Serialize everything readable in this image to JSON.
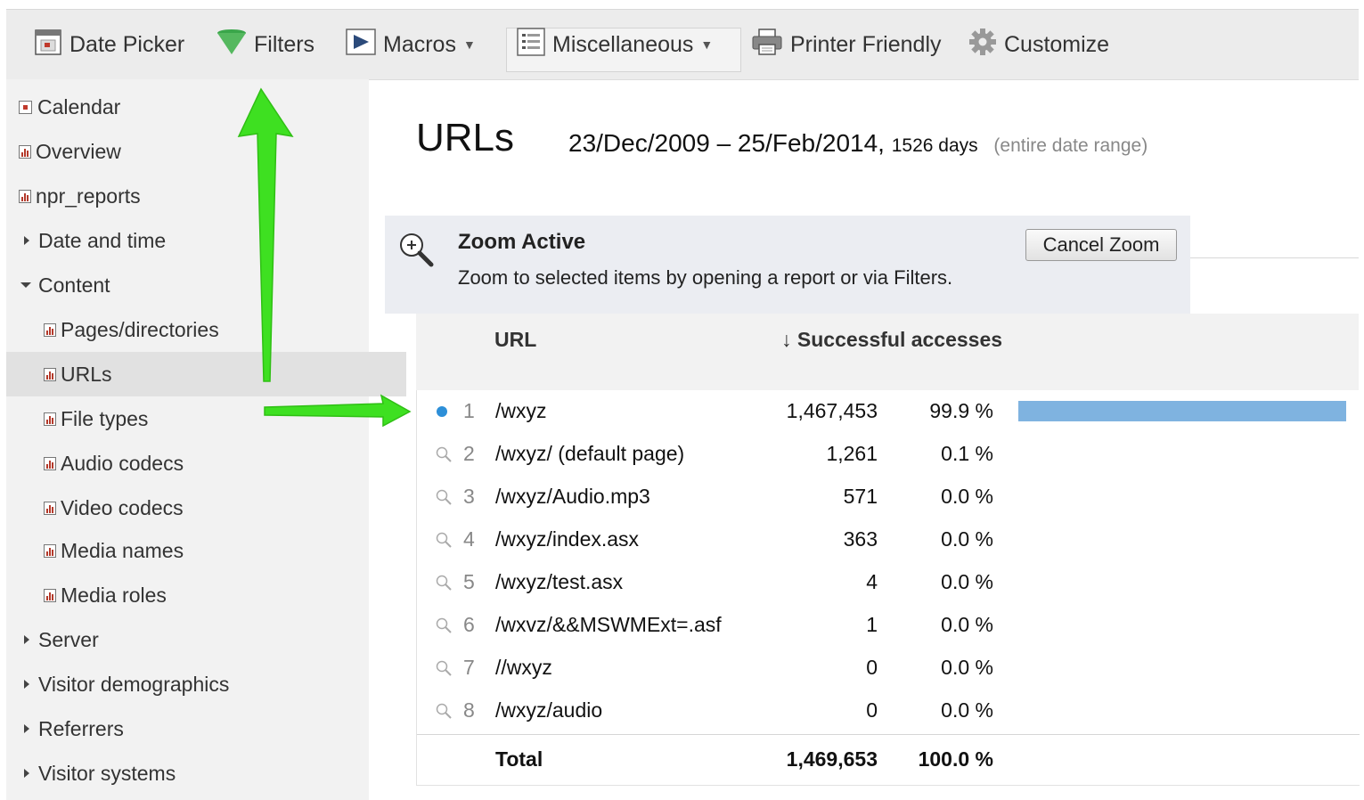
{
  "toolbar": {
    "date_picker": "Date Picker",
    "filters": "Filters",
    "macros": "Macros",
    "miscellaneous": "Miscellaneous",
    "printer_friendly": "Printer Friendly",
    "customize": "Customize"
  },
  "sidebar": {
    "items": [
      {
        "label": "Calendar",
        "icon": "calendar-icon"
      },
      {
        "label": "Overview",
        "icon": "report-icon"
      },
      {
        "label": "npr_reports",
        "icon": "report-icon"
      },
      {
        "label": "Date and time",
        "icon": "expand-arrow-icon"
      },
      {
        "label": "Content",
        "icon": "collapse-arrow-icon"
      },
      {
        "label": "Pages/directories",
        "icon": "report-icon"
      },
      {
        "label": "URLs",
        "icon": "report-icon",
        "selected": true
      },
      {
        "label": "File types",
        "icon": "report-icon"
      },
      {
        "label": "Audio codecs",
        "icon": "report-icon"
      },
      {
        "label": "Video codecs",
        "icon": "report-icon"
      },
      {
        "label": "Media names",
        "icon": "report-icon"
      },
      {
        "label": "Media roles",
        "icon": "report-icon"
      },
      {
        "label": "Server",
        "icon": "expand-arrow-icon"
      },
      {
        "label": "Visitor demographics",
        "icon": "expand-arrow-icon"
      },
      {
        "label": "Referrers",
        "icon": "expand-arrow-icon"
      },
      {
        "label": "Visitor systems",
        "icon": "expand-arrow-icon"
      }
    ]
  },
  "header": {
    "title": "URLs",
    "date_range": "23/Dec/2009 – 25/Feb/2014,",
    "days": "1526 days",
    "range_note": "(entire date range)"
  },
  "zoom": {
    "title": "Zoom Active",
    "description": "Zoom to selected items by opening a report or via Filters.",
    "cancel_label": "Cancel Zoom"
  },
  "table": {
    "col_url": "URL",
    "col_sort_arrow": "↓",
    "col_accesses": "Successful accesses",
    "rows": [
      {
        "rank": "1",
        "url": "/wxyz",
        "accesses": "1,467,453",
        "percent": "99.9 %",
        "fraction": 0.999
      },
      {
        "rank": "2",
        "url": "/wxyz/ (default page)",
        "accesses": "1,261",
        "percent": "0.1 %",
        "fraction": 0.001
      },
      {
        "rank": "3",
        "url": "/wxyz/Audio.mp3",
        "accesses": "571",
        "percent": "0.0 %",
        "fraction": 0.0
      },
      {
        "rank": "4",
        "url": "/wxyz/index.asx",
        "accesses": "363",
        "percent": "0.0 %",
        "fraction": 0.0
      },
      {
        "rank": "5",
        "url": "/wxyz/test.asx",
        "accesses": "4",
        "percent": "0.0 %",
        "fraction": 0.0
      },
      {
        "rank": "6",
        "url": "/wxvz/&&MSWMExt=.asf",
        "accesses": "1",
        "percent": "0.0 %",
        "fraction": 0.0
      },
      {
        "rank": "7",
        "url": "//wxyz",
        "accesses": "0",
        "percent": "0.0 %",
        "fraction": 0.0
      },
      {
        "rank": "8",
        "url": "/wxyz/audio",
        "accesses": "0",
        "percent": "0.0 %",
        "fraction": 0.0
      }
    ],
    "total_label": "Total",
    "total_accesses": "1,469,653",
    "total_percent": "100.0 %"
  },
  "colors": {
    "accent_bar": "#7fb3e0",
    "active_dot": "#2d8fd8",
    "annotation_arrow": "#3ee021"
  }
}
